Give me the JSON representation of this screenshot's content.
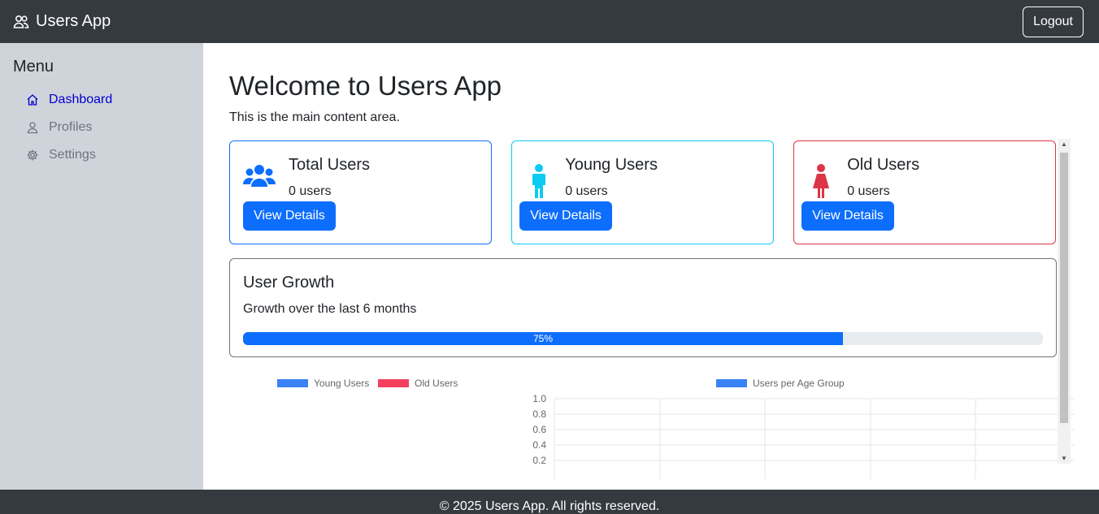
{
  "header": {
    "title": "Users App",
    "logout_label": "Logout"
  },
  "sidebar": {
    "heading": "Menu",
    "items": [
      {
        "label": "Dashboard",
        "icon": "home-icon",
        "active": true
      },
      {
        "label": "Profiles",
        "icon": "person-icon",
        "active": false
      },
      {
        "label": "Settings",
        "icon": "gear-icon",
        "active": false
      }
    ]
  },
  "main": {
    "title": "Welcome to Users App",
    "subtitle": "This is the main content area.",
    "cards": [
      {
        "title": "Total Users",
        "count": "0 users",
        "button": "View Details",
        "icon": "users-group-icon",
        "color": "#0d6efd"
      },
      {
        "title": "Young Users",
        "count": "0 users",
        "button": "View Details",
        "icon": "male-icon",
        "color": "#0dcaf0"
      },
      {
        "title": "Old Users",
        "count": "0 users",
        "button": "View Details",
        "icon": "female-icon",
        "color": "#dc3545"
      }
    ],
    "growth": {
      "title": "User Growth",
      "description": "Growth over the last 6 months",
      "progress": 75,
      "progress_label": "75%"
    }
  },
  "charts": {
    "pie_legend": [
      {
        "label": "Young Users",
        "color": "#3b82f6"
      },
      {
        "label": "Old Users",
        "color": "#f43f5e"
      }
    ],
    "bar_legend": {
      "label": "Users per Age Group",
      "color": "#3b82f6"
    },
    "y_ticks": [
      "1.0",
      "0.8",
      "0.6",
      "0.4",
      "0.2"
    ]
  },
  "footer": {
    "text": "© 2025 Users App. All rights reserved."
  }
}
